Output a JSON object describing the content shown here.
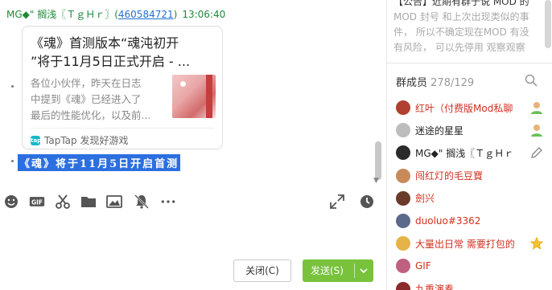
{
  "chat": {
    "sender_name": "MG◆\" 搁浅〖ＴｇＨｒ〗",
    "sender_open_paren": "(",
    "sender_id": "460584721",
    "sender_close_paren": ")",
    "time": "13:06:40",
    "card": {
      "title_line1": "《魂》首测版本“魂沌初开",
      "title_line2": "”将于11月5日正式开启 - ...",
      "desc_line1": "各位小伙伴，昨天在日志",
      "desc_line2": "中提到《魂》已经进入了",
      "desc_line3": "最后的性能优化，以及前...",
      "source": "TapTap 发现好游戏",
      "source_logo": "tap"
    },
    "selected_text": "《魂》将于11月5日开启首测"
  },
  "toolbar": {
    "icons": [
      "emoji-icon",
      "gif-icon",
      "scissors-icon",
      "folder-icon",
      "image-icon",
      "bell-off-icon",
      "more-icon",
      "expand-icon",
      "history-icon"
    ],
    "gif_label": "GIF"
  },
  "buttons": {
    "close_label": "关闭(C)",
    "send_label": "发送(S)"
  },
  "announcement": {
    "line1": "【公告】近期有群于说 MOD 的",
    "line2": "MOD 封号  和上次出现类似的事",
    "line3": "件，  所以不确定现在MOD 有没",
    "line4": "有风险，  可以先停用 观察观察"
  },
  "members": {
    "title": "群成员",
    "count": "278/129",
    "list": [
      {
        "name": "红叶（付费版Mod私聊",
        "color": "red",
        "avatar": "#b04030",
        "badge": "admin-icon"
      },
      {
        "name": "迷途的星星",
        "color": "black",
        "avatar": "#bdbdbd",
        "badge": "admin-icon"
      },
      {
        "name": "MG◆\" 搁浅〖ＴｇＨｒ",
        "color": "black",
        "avatar": "#2a2a2a",
        "badge": "edit-icon"
      },
      {
        "name": "闯红灯的毛豆寶",
        "color": "red",
        "avatar": "#c98a5a",
        "badge": ""
      },
      {
        "name": "劍兴",
        "color": "red",
        "avatar": "#6a3b2b",
        "badge": ""
      },
      {
        "name": "duoluo#3362",
        "color": "red",
        "avatar": "#5b6a8a",
        "badge": ""
      },
      {
        "name": "大量出日常 需要打包的",
        "color": "red",
        "avatar": "#e5b347",
        "badge": "star-icon"
      },
      {
        "name": "GIF",
        "color": "red",
        "avatar": "#c06080",
        "badge": ""
      },
      {
        "name": "九重演奏",
        "color": "red",
        "avatar": "#8a2a2a",
        "badge": ""
      }
    ]
  }
}
